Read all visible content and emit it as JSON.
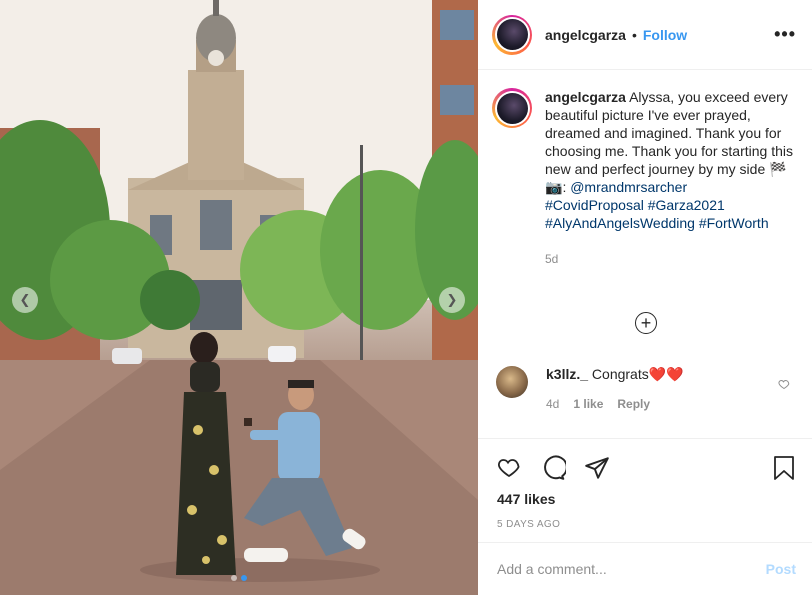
{
  "post": {
    "username": "angelcgarza",
    "separator": "•",
    "follow_label": "Follow",
    "more_label": "•••",
    "caption_username": "angelcgarza",
    "caption_text": "Alyssa, you exceed every beautiful picture I've ever prayed, dreamed and imagined. Thank you for choosing me. Thank you for starting this new and perfect journey by my side",
    "caption_emoji": "🏁",
    "camera_emoji": "📷",
    "photo_credit_prefix": ":",
    "mention": "@mrandmrsarcher",
    "hashtags_line1": "#CovidProposal #Garza2021",
    "hashtags_line2": "#AlyAndAngelsWedding #FortWorth",
    "age": "5d"
  },
  "comments": [
    {
      "username": "k3llz._",
      "text": "Congrats",
      "emoji": "❤️❤️",
      "time": "4d",
      "likes": "1 like",
      "reply_label": "Reply"
    }
  ],
  "likes_label": "447 likes",
  "posted_label": "5 DAYS AGO",
  "add_comment": {
    "placeholder": "Add a comment...",
    "post_label": "Post"
  },
  "icons": [
    "more-icon",
    "plus-circle-icon",
    "heart-icon",
    "comment-icon",
    "share-icon",
    "bookmark-icon",
    "chevron-left-icon",
    "chevron-right-icon"
  ],
  "colors": {
    "accent": "#3897f0",
    "link": "#00376b",
    "muted": "#8e8e8e",
    "post_disabled": "#b3dbff"
  },
  "carousel": {
    "total": 2,
    "active": 2
  }
}
